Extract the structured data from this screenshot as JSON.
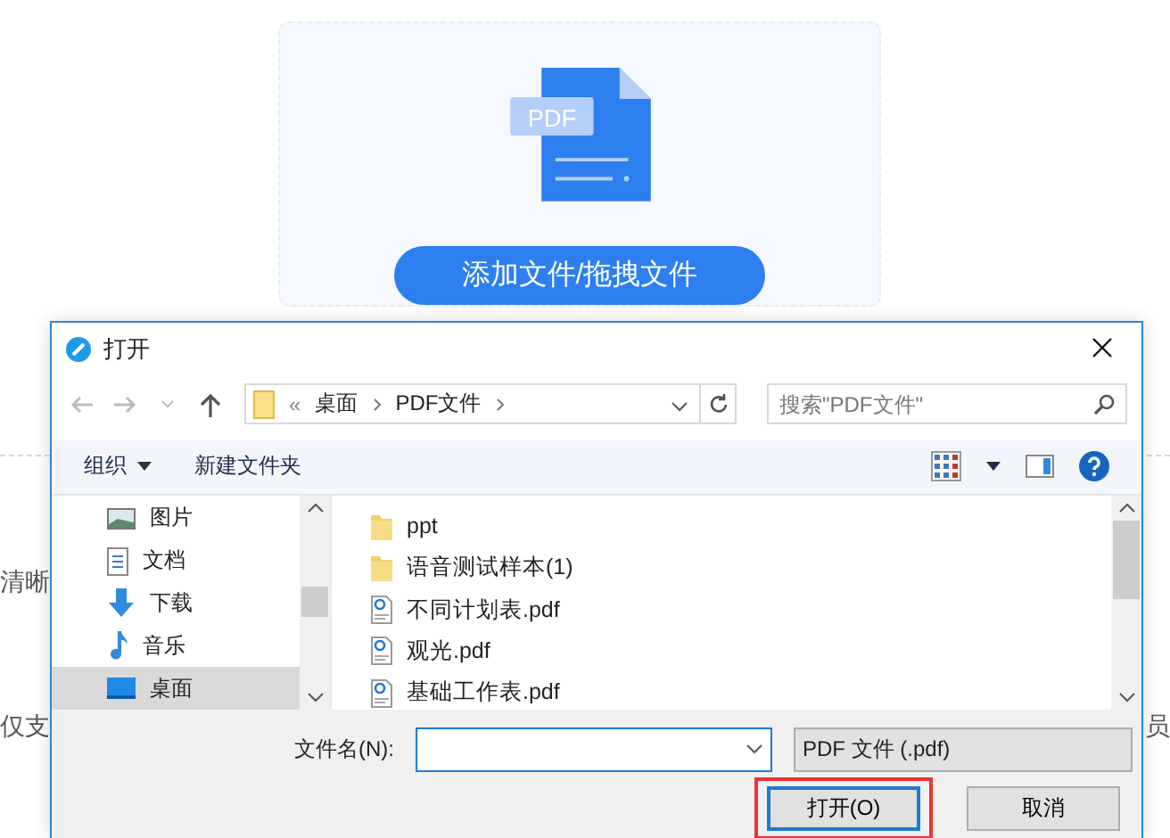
{
  "upload": {
    "icon_label": "PDF",
    "button": "添加文件/拖拽文件"
  },
  "background": {
    "left_texts": [
      "清晰",
      "仅支"
    ],
    "right_texts": [
      "员"
    ]
  },
  "dialog": {
    "title": "打开",
    "breadcrumb": [
      "«",
      "桌面",
      "PDF文件"
    ],
    "search": {
      "placeholder": "搜索\"PDF文件\""
    },
    "toolbar": [
      {
        "label": "组织",
        "has_menu": true
      },
      {
        "label": "新建文件夹",
        "has_menu": false
      }
    ],
    "nav_items": [
      {
        "label": "图片",
        "kind": "pictures",
        "selected": false
      },
      {
        "label": "文档",
        "kind": "documents",
        "selected": false
      },
      {
        "label": "下载",
        "kind": "downloads",
        "selected": false
      },
      {
        "label": "音乐",
        "kind": "music",
        "selected": false
      },
      {
        "label": "桌面",
        "kind": "desktop",
        "selected": true
      }
    ],
    "files": [
      {
        "name": "ppt",
        "kind": "folder"
      },
      {
        "name": "语音测试样本(1)",
        "kind": "folder"
      },
      {
        "name": "不同计划表.pdf",
        "kind": "pdf"
      },
      {
        "name": "观光.pdf",
        "kind": "pdf"
      },
      {
        "name": "基础工作表.pdf",
        "kind": "pdf"
      }
    ],
    "filename_label": "文件名(N):",
    "file_type": "PDF 文件 (.pdf)",
    "buttons": [
      {
        "label": "打开(O)",
        "default": true,
        "highlighted": true
      },
      {
        "label": "取消",
        "default": false,
        "highlighted": false
      }
    ]
  }
}
